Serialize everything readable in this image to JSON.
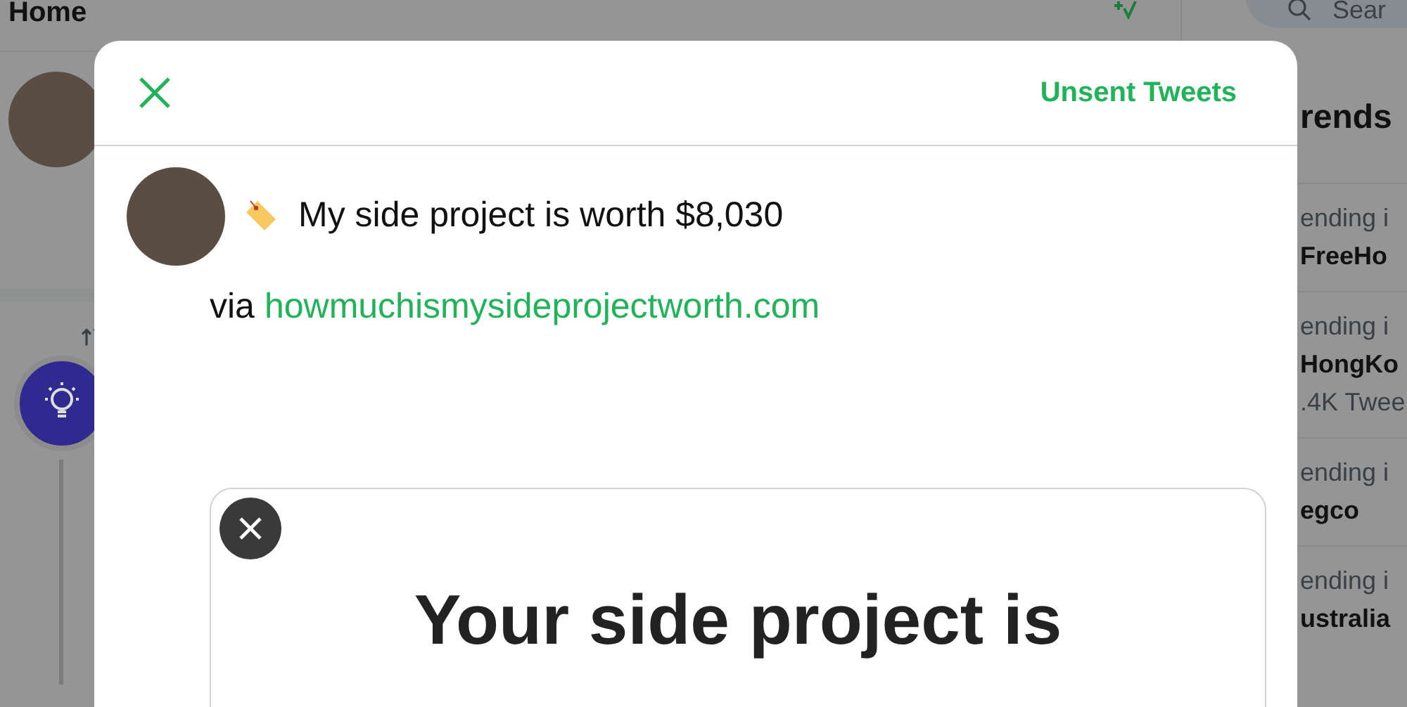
{
  "background": {
    "header_title": "Home",
    "search": {
      "placeholder": "Sear"
    },
    "trends_title": "rends",
    "trends": [
      {
        "context": "ending i",
        "name": "FreeHo"
      },
      {
        "context": "ending i",
        "name": "HongKo",
        "count": ".4K Twee"
      },
      {
        "context": "ending i",
        "name": "egco"
      },
      {
        "context": "ending i",
        "name": "ustralia"
      }
    ]
  },
  "modal": {
    "action": "Unsent Tweets",
    "tweet": {
      "text": "My side project is worth $8,030",
      "via": "via",
      "link": "howmuchismysideprojectworth.com"
    },
    "card": {
      "title": "Your side project is"
    }
  }
}
